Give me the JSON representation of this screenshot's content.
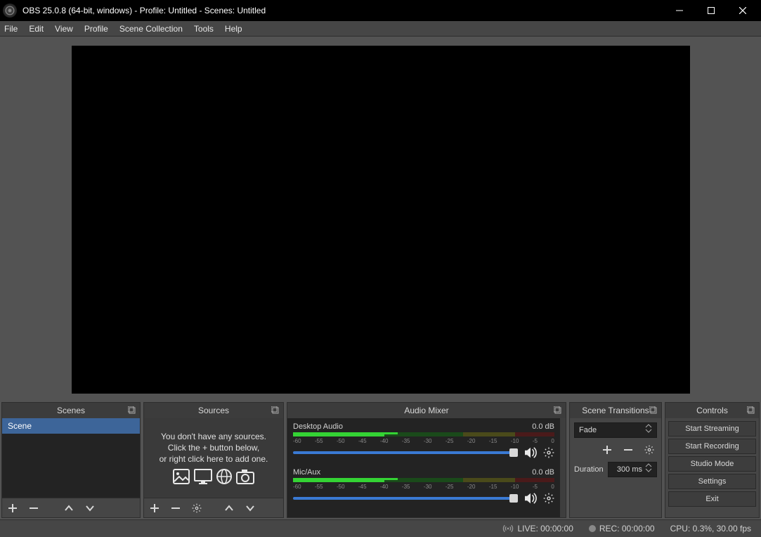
{
  "titlebar": {
    "title": "OBS 25.0.8 (64-bit, windows) - Profile: Untitled - Scenes: Untitled"
  },
  "menus": [
    "File",
    "Edit",
    "View",
    "Profile",
    "Scene Collection",
    "Tools",
    "Help"
  ],
  "scenes": {
    "header": "Scenes",
    "items": [
      "Scene"
    ]
  },
  "sources": {
    "header": "Sources",
    "empty_line1": "You don't have any sources.",
    "empty_line2": "Click the + button below,",
    "empty_line3": "or right click here to add one."
  },
  "mixer": {
    "header": "Audio Mixer",
    "channels": [
      {
        "name": "Desktop Audio",
        "level": "0.0 dB"
      },
      {
        "name": "Mic/Aux",
        "level": "0.0 dB"
      }
    ],
    "ticks": [
      "-60",
      "-55",
      "-50",
      "-45",
      "-40",
      "-35",
      "-30",
      "-25",
      "-20",
      "-15",
      "-10",
      "-5",
      "0"
    ]
  },
  "transitions": {
    "header": "Scene Transitions",
    "current": "Fade",
    "duration_label": "Duration",
    "duration_value": "300 ms"
  },
  "controls": {
    "header": "Controls",
    "buttons": [
      "Start Streaming",
      "Start Recording",
      "Studio Mode",
      "Settings",
      "Exit"
    ]
  },
  "status": {
    "live": "LIVE: 00:00:00",
    "rec": "REC: 00:00:00",
    "cpu": "CPU: 0.3%, 30.00 fps"
  }
}
